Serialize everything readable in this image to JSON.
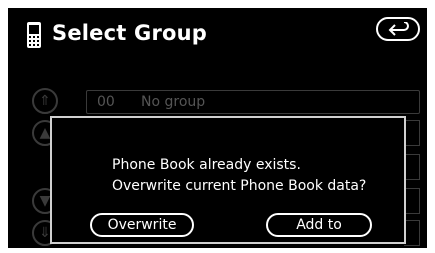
{
  "header": {
    "title": "Select Group",
    "phone_icon": "mobile-phone-icon",
    "return_icon": "return-arrow-icon"
  },
  "list": {
    "rows": [
      {
        "number": "00",
        "label": "No group"
      }
    ],
    "controls": [
      "page-up-icon",
      "scroll-up-icon",
      "scroll-down-icon",
      "page-down-icon"
    ]
  },
  "dialog": {
    "line1": "Phone Book already exists.",
    "line2": "Overwrite current Phone Book data?",
    "overwrite_label": "Overwrite",
    "add_label": "Add to"
  },
  "colors": {
    "background": "#000000",
    "text": "#ffffff",
    "dimmed": "#3a3a3a"
  }
}
